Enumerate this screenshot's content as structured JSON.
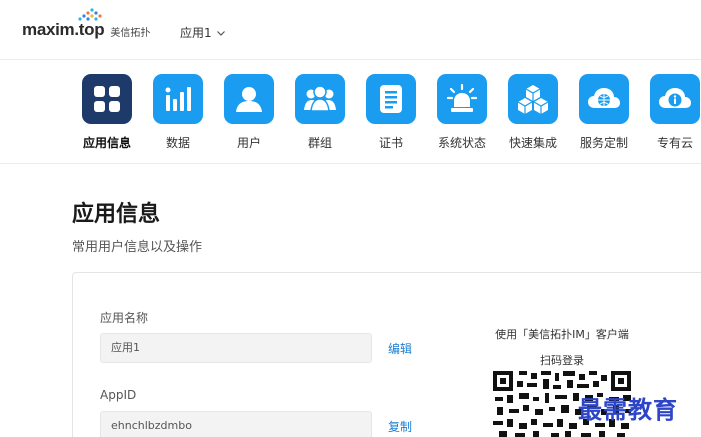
{
  "header": {
    "logo_text": "maxim.top",
    "logo_sub": "美信拓扑",
    "app_selector": "应用1"
  },
  "nav": {
    "items": [
      {
        "label": "应用信息",
        "icon": "grid-icon",
        "active": true
      },
      {
        "label": "数据",
        "icon": "bar-chart-icon",
        "active": false
      },
      {
        "label": "用户",
        "icon": "user-icon",
        "active": false
      },
      {
        "label": "群组",
        "icon": "group-icon",
        "active": false
      },
      {
        "label": "证书",
        "icon": "document-icon",
        "active": false
      },
      {
        "label": "系统状态",
        "icon": "alarm-light-icon",
        "active": false
      },
      {
        "label": "快速集成",
        "icon": "cubes-icon",
        "active": false
      },
      {
        "label": "服务定制",
        "icon": "cloud-globe-icon",
        "active": false
      },
      {
        "label": "专有云",
        "icon": "cloud-info-icon",
        "active": false
      }
    ]
  },
  "main": {
    "title": "应用信息",
    "subtitle": "常用用户信息以及操作"
  },
  "card": {
    "app_name_label": "应用名称",
    "app_name_value": "应用1",
    "app_name_action": "编辑",
    "appid_label": "AppID",
    "appid_value": "ehnchlbzdmbo",
    "appid_action": "复制",
    "qr_line1": "使用「美信拓扑IM」客户端",
    "qr_line2": "扫码登录"
  },
  "watermark": "最需教育",
  "colors": {
    "accent": "#1a9cf0",
    "active_icon": "#1d3a6b",
    "link": "#1a7fd6",
    "watermark": "#2d45c8"
  }
}
